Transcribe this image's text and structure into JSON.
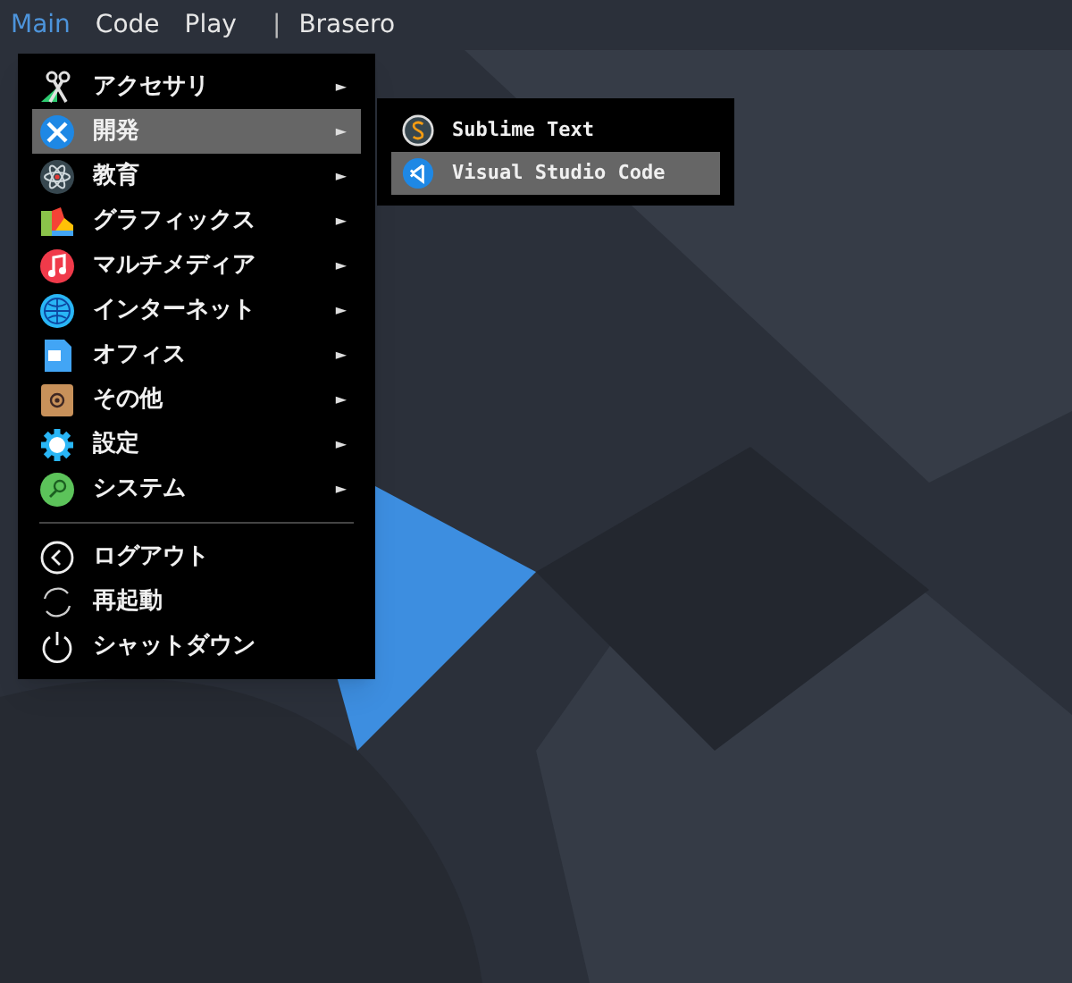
{
  "top_bar": {
    "items": [
      {
        "label": "Main",
        "selected": true
      },
      {
        "label": "Code",
        "selected": false
      },
      {
        "label": "Play",
        "selected": false
      }
    ],
    "separator": "|",
    "extra": "Brasero"
  },
  "menu": {
    "categories": [
      {
        "label": "アクセサリ",
        "selected": false,
        "arrow": "►"
      },
      {
        "label": "開発",
        "selected": true,
        "arrow": "►"
      },
      {
        "label": "教育",
        "selected": false,
        "arrow": "►"
      },
      {
        "label": "グラフィックス",
        "selected": false,
        "arrow": "►"
      },
      {
        "label": "マルチメディア",
        "selected": false,
        "arrow": "►"
      },
      {
        "label": "インターネット",
        "selected": false,
        "arrow": "►"
      },
      {
        "label": "オフィス",
        "selected": false,
        "arrow": "►"
      },
      {
        "label": "その他",
        "selected": false,
        "arrow": "►"
      },
      {
        "label": "設定",
        "selected": false,
        "arrow": "►"
      },
      {
        "label": "システム",
        "selected": false,
        "arrow": "►"
      }
    ],
    "actions": [
      {
        "label": "ログアウト"
      },
      {
        "label": "再起動"
      },
      {
        "label": "シャットダウン"
      }
    ]
  },
  "submenu": {
    "items": [
      {
        "label": "Sublime Text",
        "selected": false
      },
      {
        "label": "Visual Studio Code",
        "selected": true
      }
    ]
  }
}
